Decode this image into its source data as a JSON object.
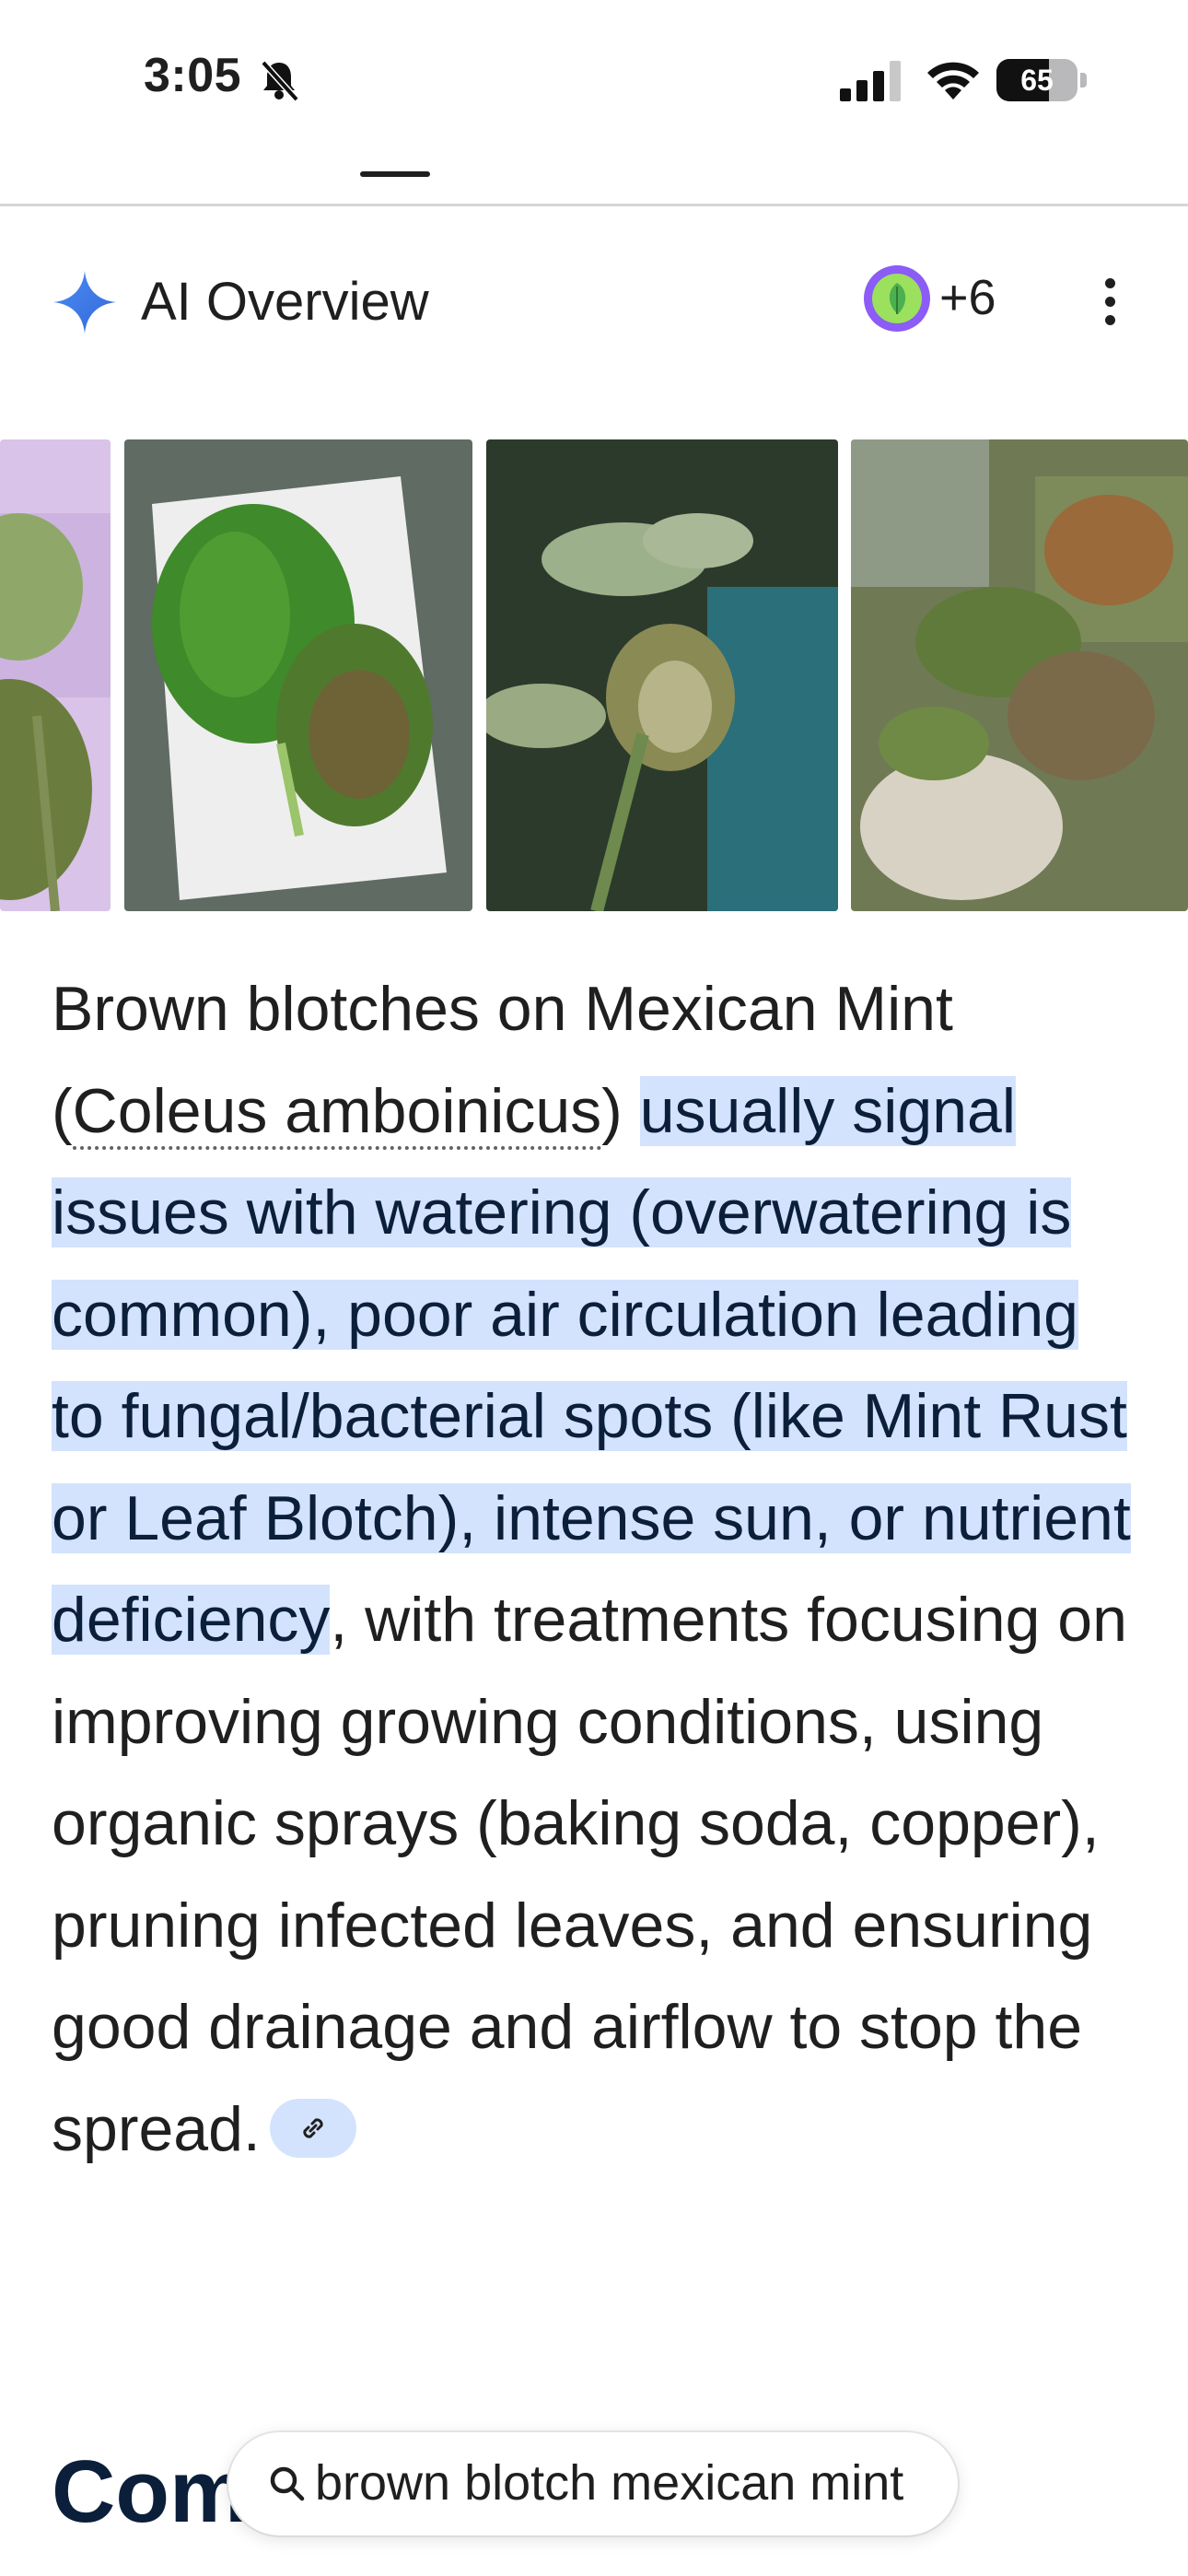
{
  "status_bar": {
    "time": "3:05",
    "battery_level": 65,
    "battery_label": "65",
    "icons": [
      "bell-slash-icon",
      "cellular-signal-icon",
      "wifi-icon",
      "battery-icon"
    ]
  },
  "ai_overview": {
    "title": "AI Overview",
    "sources_more": "+6",
    "accent_color": "#4285f4"
  },
  "images": [
    {
      "alt": "coleus-leaf-partial"
    },
    {
      "alt": "leaves-with-brown-blotches-on-paper-towel"
    },
    {
      "alt": "plant-with-browning-leaf-in-blue-pot"
    },
    {
      "alt": "mint-plant-in-pot-outdoors"
    }
  ],
  "summary": {
    "lead": "Brown blotches on Mexican Mint (",
    "term": "Coleus amboinicus",
    "after_term": ") ",
    "highlight": "usually signal issues with watering (overwatering is common), poor air circulation leading to fungal/bacterial spots (like Mint Rust or Leaf Blotch), intense sun, or nutrient deficiency",
    "tail": ", with treatments focusing on improving growing conditions, using organic sprays (baking soda, copper), pruning infected leaves, and ensuring good drainage and airflow to stop the spread.",
    "highlight_color": "#d3e3fd"
  },
  "section": {
    "heading": "Common Causes & "
  },
  "search": {
    "query": "brown blotch mexican mint"
  }
}
